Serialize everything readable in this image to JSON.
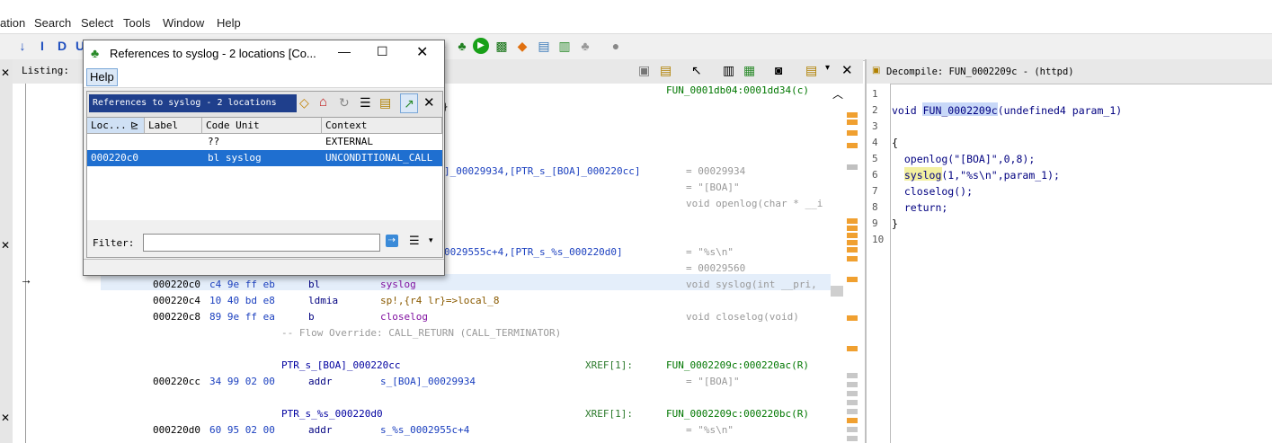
{
  "menu": [
    "ation",
    "Search",
    "Select",
    "Tools",
    "Window",
    "Help"
  ],
  "listing": {
    "tab_label": "Listing:",
    "rows": [
      {
        "type": "xref_top",
        "text": "FUN_0001db04:0001dd34(c)"
      },
      {
        "type": "fragment",
        "text": "}"
      },
      {
        "type": "operand_only",
        "operand": "]_00029934,[PTR_s_[BOA]_000220cc]",
        "comment": "= 00029934"
      },
      {
        "type": "comment_only",
        "comment": "= \"[BOA]\""
      },
      {
        "type": "comment_only",
        "comment": "void openlog(char * __i"
      },
      {
        "type": "operand_only",
        "operand": "0029555c+4,[PTR_s_%s_000220d0]",
        "comment": "= \"%s\\n\""
      },
      {
        "type": "comment_only",
        "comment": "= 00029560"
      },
      {
        "type": "instr",
        "addr": "000220c0",
        "bytes": "c4 9e ff eb",
        "mnem": "bl",
        "operand": "syslog",
        "comment": "void syslog(int __pri,"
      },
      {
        "type": "instr",
        "addr": "000220c4",
        "bytes": "10 40 bd e8",
        "mnem": "ldmia",
        "operand": "sp!,{r4 lr}=>local_8",
        "comment": ""
      },
      {
        "type": "instr",
        "addr": "000220c8",
        "bytes": "89 9e ff ea",
        "mnem": "b",
        "operand": "closelog",
        "comment": "void closelog(void)"
      },
      {
        "type": "flow",
        "text": "-- Flow Override: CALL_RETURN (CALL_TERMINATOR)"
      },
      {
        "type": "label",
        "label": "PTR_s_[BOA]_000220cc",
        "xref": "XREF[1]:",
        "xref_target": "FUN_0002209c:000220ac(R)"
      },
      {
        "type": "instr",
        "addr": "000220cc",
        "bytes": "34 99 02 00",
        "mnem": "addr",
        "operand": "s_[BOA]_00029934",
        "comment": "= \"[BOA]\""
      },
      {
        "type": "label",
        "label": "PTR_s_%s_000220d0",
        "xref": "XREF[1]:",
        "xref_target": "FUN_0002209c:000220bc(R)"
      },
      {
        "type": "instr",
        "addr": "000220d0",
        "bytes": "60 95 02 00",
        "mnem": "addr",
        "operand": "s_%s_0002955c+4",
        "comment": "= \"%s\\n\""
      }
    ]
  },
  "decompile": {
    "tab_label": "Decompile: FUN_0002209c -  (httpd)",
    "line_numbers": [
      "1",
      "2",
      "3",
      "4",
      "5",
      "6",
      "7",
      "8",
      "9",
      "10"
    ],
    "lines": [
      "",
      "void FUN_0002209c(undefined4 param_1)",
      "",
      "{",
      "  openlog(\"[BOA]\",0,8);",
      "  syslog(1,\"%s\\n\",param_1);",
      "  closelog();",
      "  return;",
      "}",
      ""
    ]
  },
  "dialog": {
    "title": "References to syslog - 2 locations [Co...",
    "menu_help": "Help",
    "panel_title": "References to syslog - 2 locations",
    "columns": [
      "Loc...",
      "Label",
      "Code Unit",
      "Context"
    ],
    "rows": [
      {
        "loc": "",
        "label": "",
        "code_unit": "??",
        "context": "EXTERNAL"
      },
      {
        "loc": "000220c0",
        "label": "",
        "code_unit": "bl syslog",
        "context": "UNCONDITIONAL_CALL"
      }
    ],
    "filter_label": "Filter:",
    "filter_value": ""
  },
  "colors": {
    "selection_blue": "#1f6fd0",
    "dialog_title_bar": "#1f3f8c",
    "highlight_row": "#e4eefa",
    "syslog_highlight": "#f3f0a0",
    "func_highlight": "#c8d8f8"
  }
}
